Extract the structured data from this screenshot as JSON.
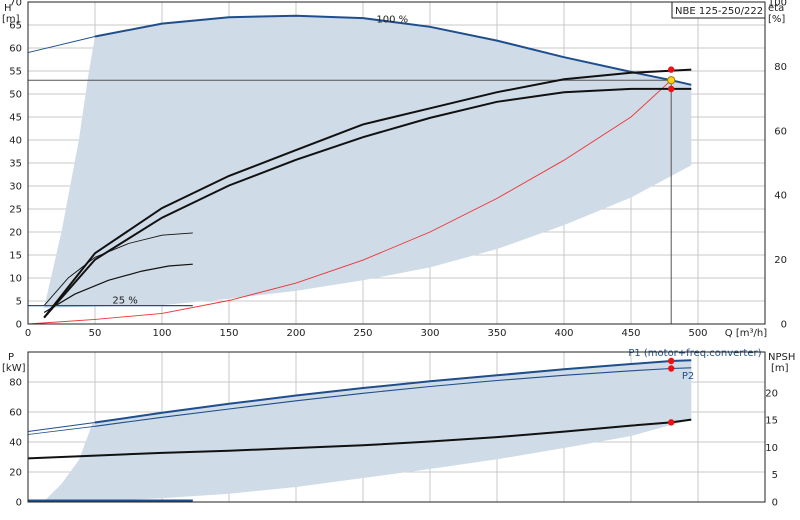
{
  "chart_data": [
    {
      "type": "line",
      "title": "NBE 125-250/222",
      "xlabel": "Q [m³/h]",
      "ylabel": "H",
      "ylabel_unit": "[m]",
      "y2label": "eta",
      "y2label_unit": "[%]",
      "xlim": [
        0,
        550
      ],
      "ylim": [
        0,
        70
      ],
      "y2lim": [
        0,
        100
      ],
      "xticks": [
        0,
        50,
        100,
        150,
        200,
        250,
        300,
        350,
        400,
        450,
        500
      ],
      "yticks": [
        0,
        5,
        10,
        15,
        20,
        25,
        30,
        35,
        40,
        45,
        50,
        55,
        60,
        65,
        70
      ],
      "y2ticks": [
        0,
        20,
        40,
        60,
        80,
        100
      ],
      "grid": true,
      "annotations": {
        "curve_100": "100 %",
        "curve_25": "25 %"
      },
      "operating_point": {
        "q": 480,
        "h": 53
      },
      "head_100": {
        "x": [
          0,
          50,
          100,
          150,
          200,
          250,
          300,
          350,
          400,
          450,
          480,
          495
        ],
        "y": [
          59,
          62.5,
          65.3,
          66.7,
          67,
          66.5,
          64.6,
          61.6,
          58,
          54.8,
          53,
          52
        ]
      },
      "envelope_lower": {
        "x": [
          50,
          100,
          150,
          200,
          250,
          300,
          350,
          400,
          450,
          495
        ],
        "y": [
          3.8,
          4.1,
          5.5,
          7.2,
          9.5,
          12.3,
          16.3,
          21.5,
          27.5,
          34.5
        ]
      },
      "envelope_left": {
        "x": [
          12,
          25,
          38,
          45,
          50
        ],
        "y": [
          3.5,
          20,
          40,
          54,
          62.5
        ]
      },
      "system_curve": {
        "x": [
          0,
          50,
          100,
          150,
          200,
          250,
          300,
          350,
          400,
          450,
          480
        ],
        "y": [
          0,
          1,
          2.3,
          5.1,
          8.9,
          13.9,
          20,
          27.3,
          35.6,
          45,
          53
        ]
      },
      "efficiency_curves": [
        {
          "x": [
            12,
            50,
            100,
            150,
            200,
            250,
            300,
            350,
            400,
            450,
            495
          ],
          "y": [
            2,
            22,
            36,
            46,
            54,
            62,
            67,
            72,
            76,
            78,
            79
          ]
        },
        {
          "x": [
            12,
            50,
            100,
            150,
            200,
            250,
            300,
            350,
            400,
            450,
            495
          ],
          "y": [
            2,
            20,
            33,
            43,
            51,
            58,
            64,
            69,
            72,
            73,
            73
          ]
        }
      ],
      "small_curves": [
        {
          "x": [
            12,
            30,
            50,
            75,
            100,
            123
          ],
          "y": [
            4,
            10,
            14.5,
            17.5,
            19.3,
            19.8
          ]
        },
        {
          "x": [
            12,
            35,
            60,
            85,
            105,
            123
          ],
          "y": [
            2.5,
            6.5,
            9.5,
            11.5,
            12.6,
            13
          ]
        }
      ],
      "low_line": {
        "x": [
          0,
          50,
          100,
          123
        ],
        "y": [
          4,
          4,
          4,
          4
        ]
      },
      "eta_markers": [
        {
          "x": 480,
          "y2": 79
        },
        {
          "x": 480,
          "y2": 73
        }
      ]
    },
    {
      "type": "line",
      "xlim": [
        0,
        550
      ],
      "ylabel": "P",
      "ylabel_unit": "[kW]",
      "ylim": [
        0,
        100
      ],
      "yticks": [
        0,
        20,
        40,
        60,
        80
      ],
      "y2label": "NPSH",
      "y2label_unit": "[m]",
      "y2lim": [
        0,
        27.5
      ],
      "y2ticks": [
        0,
        5,
        10,
        15,
        20
      ],
      "grid": true,
      "series": [
        {
          "name": "P1 (motor+freq.converter)",
          "x": [
            0,
            50,
            100,
            150,
            200,
            250,
            300,
            350,
            400,
            450,
            480,
            495
          ],
          "y": [
            47,
            53,
            59.5,
            65.5,
            71,
            76,
            80.5,
            84.5,
            88.5,
            92,
            94,
            94.5
          ]
        },
        {
          "name": "P2",
          "x": [
            0,
            50,
            100,
            150,
            200,
            250,
            300,
            350,
            400,
            450,
            480,
            495
          ],
          "y": [
            45,
            50.5,
            56.5,
            62,
            67.5,
            72.5,
            77,
            81,
            84.5,
            87.5,
            89,
            89.5
          ]
        }
      ],
      "npsh": {
        "x": [
          0,
          50,
          100,
          150,
          200,
          250,
          300,
          350,
          400,
          450,
          480,
          495
        ],
        "y2": [
          8,
          8.5,
          9,
          9.4,
          9.9,
          10.4,
          11.1,
          11.9,
          12.9,
          14,
          14.6,
          15.1
        ]
      },
      "envelope_lower": {
        "x": [
          48,
          100,
          150,
          200,
          250,
          300,
          350,
          400,
          450,
          495
        ],
        "y": [
          0.5,
          2.5,
          5.5,
          10,
          16,
          22,
          28.5,
          36,
          44,
          55
        ]
      },
      "envelope_left": {
        "x": [
          12,
          25,
          38,
          48
        ],
        "y": [
          0.5,
          12,
          28,
          52
        ]
      },
      "low_line": {
        "x": [
          0,
          50,
          100,
          123
        ],
        "y": [
          1,
          1,
          1,
          1
        ]
      },
      "markers": [
        {
          "x": 480,
          "y": 94
        },
        {
          "x": 480,
          "y": 89
        },
        {
          "x": 480,
          "y2": 14.6
        }
      ]
    }
  ]
}
